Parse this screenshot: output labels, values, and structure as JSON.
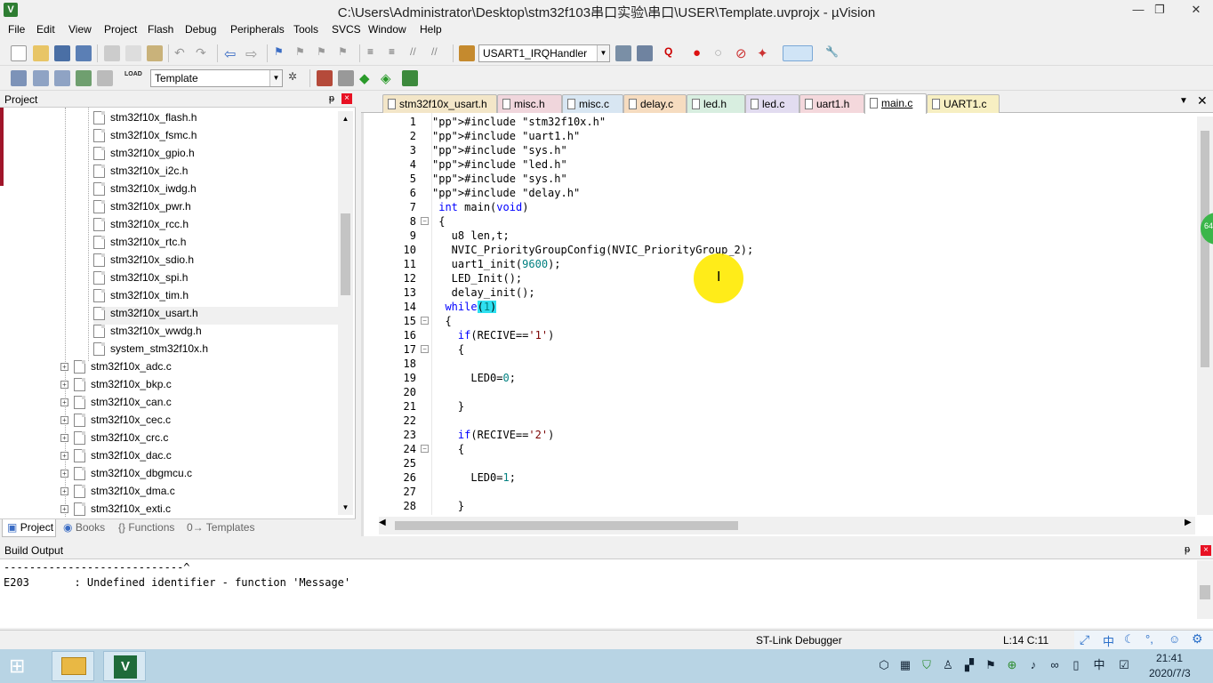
{
  "window": {
    "title": "C:\\Users\\Administrator\\Desktop\\stm32f103串口实验\\串口\\USER\\Template.uvprojx - µVision",
    "app_icon": "V",
    "minimize": "—",
    "maximize": "❐",
    "close": "✕"
  },
  "menu": [
    "File",
    "Edit",
    "View",
    "Project",
    "Flash",
    "Debug",
    "Peripherals",
    "Tools",
    "SVCS",
    "Window",
    "Help"
  ],
  "toolbar": {
    "function_combo": "USART1_IRQHandler",
    "target_combo": "Template",
    "load_label": "LOAD"
  },
  "project": {
    "title": "Project",
    "pin": "ᵽ",
    "close": "×",
    "headers": [
      "stm32f10x_flash.h",
      "stm32f10x_fsmc.h",
      "stm32f10x_gpio.h",
      "stm32f10x_i2c.h",
      "stm32f10x_iwdg.h",
      "stm32f10x_pwr.h",
      "stm32f10x_rcc.h",
      "stm32f10x_rtc.h",
      "stm32f10x_sdio.h",
      "stm32f10x_spi.h",
      "stm32f10x_tim.h",
      "stm32f10x_usart.h",
      "stm32f10x_wwdg.h",
      "system_stm32f10x.h"
    ],
    "sources": [
      "stm32f10x_adc.c",
      "stm32f10x_bkp.c",
      "stm32f10x_can.c",
      "stm32f10x_cec.c",
      "stm32f10x_crc.c",
      "stm32f10x_dac.c",
      "stm32f10x_dbgmcu.c",
      "stm32f10x_dma.c",
      "stm32f10x_exti.c"
    ],
    "tabs": [
      "Project",
      "Books",
      "{} Functions",
      "0→ Templates"
    ]
  },
  "editor": {
    "tabs": [
      {
        "label": "stm32f10x_usart.h",
        "color": "#f3e6c8"
      },
      {
        "label": "misc.h",
        "color": "#f0d6dc"
      },
      {
        "label": "misc.c",
        "color": "#d8e6f2"
      },
      {
        "label": "delay.c",
        "color": "#f6dcc0"
      },
      {
        "label": "led.h",
        "color": "#d8eee0"
      },
      {
        "label": "led.c",
        "color": "#e2dcf0"
      },
      {
        "label": "uart1.h",
        "color": "#f4d8dc"
      },
      {
        "label": "main.c",
        "color": "#ffffff"
      },
      {
        "label": "UART1.c",
        "color": "#f7efc2"
      }
    ],
    "active_tab": "main.c",
    "line_numbers": [
      "1",
      "2",
      "3",
      "4",
      "5",
      "6",
      "7",
      "8",
      "9",
      "10",
      "11",
      "12",
      "13",
      "14",
      "15",
      "16",
      "17",
      "18",
      "19",
      "20",
      "21",
      "22",
      "23",
      "24",
      "25",
      "26",
      "27",
      "28"
    ],
    "code": [
      "#include \"stm32f10x.h\"",
      "#include \"uart1.h\"",
      "#include \"sys.h\"",
      "#include \"led.h\"",
      "#include \"sys.h\"",
      "#include \"delay.h\"",
      " int main(void)",
      " {",
      "   u8 len,t;",
      "   NVIC_PriorityGroupConfig(NVIC_PriorityGroup_2);",
      "   uart1_init(9600);",
      "   LED_Init();",
      "   delay_init();",
      "  while(1)",
      "  {",
      "    if(RECIVE=='1')",
      "    {",
      "",
      "      LED0=0;",
      "",
      "    }",
      "",
      "    if(RECIVE=='2')",
      "    {",
      "",
      "      LED0=1;",
      "",
      "    }"
    ]
  },
  "build": {
    "title": "Build Output",
    "lines": [
      "----------------------------^",
      "E203       : Undefined identifier - function 'Message'"
    ]
  },
  "status": {
    "debugger": "ST-Link Debugger",
    "position": "L:14 C:11"
  },
  "taskbar": {
    "time": "21:41",
    "date": "2020/7/3",
    "ime": "中"
  },
  "colors": {
    "accent_yellow": "#ffea00",
    "active_tab": "#ffffff"
  }
}
